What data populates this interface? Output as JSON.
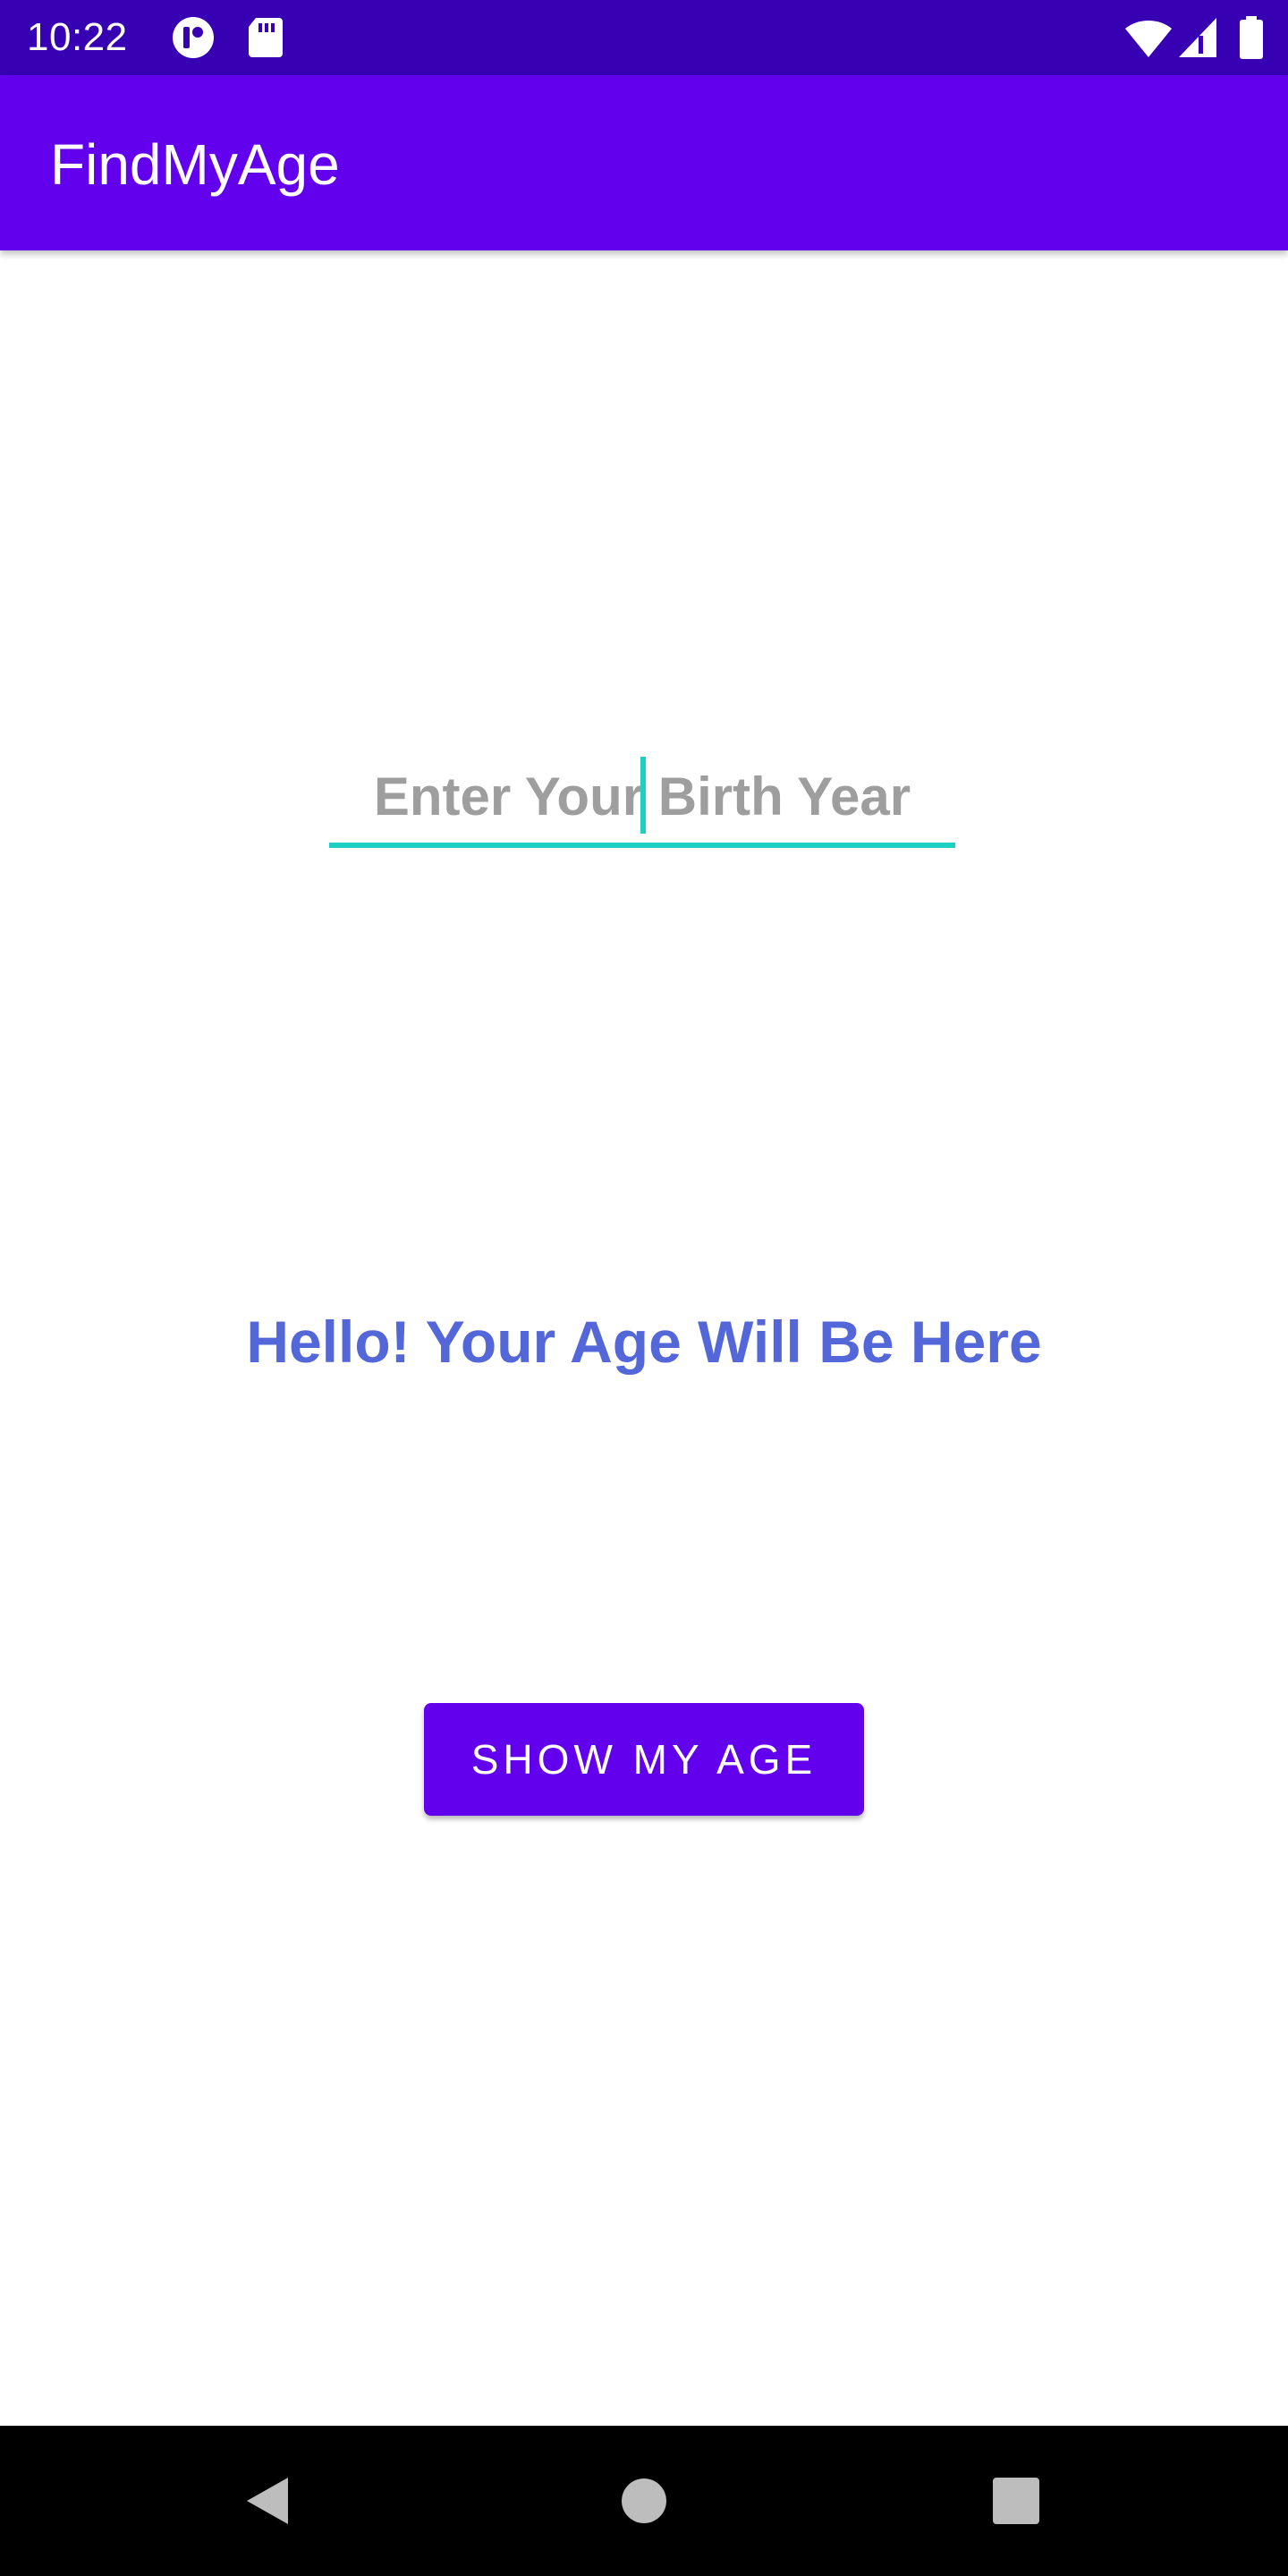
{
  "status_bar": {
    "time": "10:22",
    "left_icons": [
      "notification-app-icon",
      "sd-card-icon"
    ],
    "right_icons": [
      "wifi-icon",
      "cell-signal-icon",
      "battery-icon"
    ],
    "background": "#3700B3"
  },
  "app_bar": {
    "title": "FindMyAge",
    "background": "#6200EE"
  },
  "year_input": {
    "value": "",
    "placeholder": "Enter Your Birth Year",
    "accent": "#1ECFC4"
  },
  "age_label": {
    "text": "Hello! Your Age Will Be Here",
    "color": "#5467D8"
  },
  "show_button": {
    "label": "SHOW MY AGE",
    "background": "#6200EE"
  },
  "nav_bar": {
    "buttons": [
      "back-icon",
      "home-icon",
      "recents-icon"
    ]
  }
}
